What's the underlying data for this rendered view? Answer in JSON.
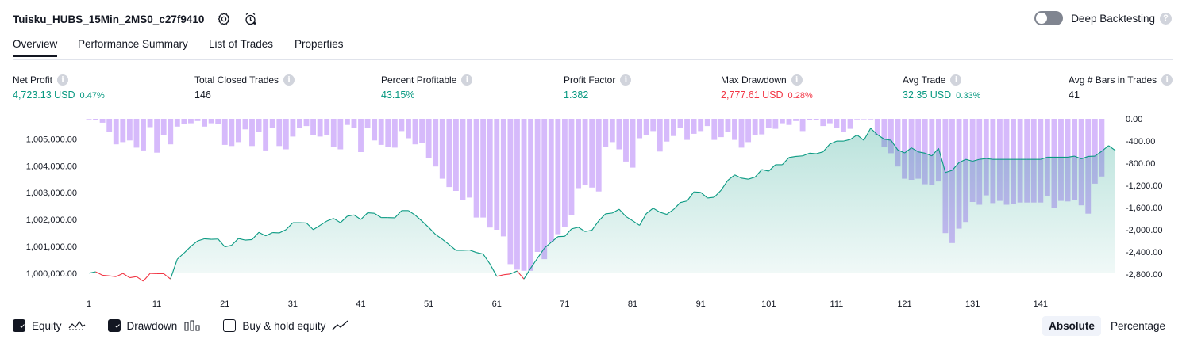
{
  "header": {
    "strategy_name": "Tuisku_HUBS_15Min_2MS0_c27f9410",
    "deep_backtesting_label": "Deep Backtesting",
    "deep_backtesting_enabled": false,
    "icons": [
      "settings-icon",
      "add-alert-icon",
      "help-icon"
    ]
  },
  "tabs": [
    {
      "label": "Overview",
      "active": true
    },
    {
      "label": "Performance Summary",
      "active": false
    },
    {
      "label": "List of Trades",
      "active": false
    },
    {
      "label": "Properties",
      "active": false
    }
  ],
  "stats": [
    {
      "label": "Net Profit",
      "value": "4,723.13 USD",
      "pct": "0.47%",
      "tone": "pos"
    },
    {
      "label": "Total Closed Trades",
      "value": "146",
      "pct": "",
      "tone": "neu"
    },
    {
      "label": "Percent Profitable",
      "value": "43.15%",
      "pct": "",
      "tone": "pos"
    },
    {
      "label": "Profit Factor",
      "value": "1.382",
      "pct": "",
      "tone": "pos"
    },
    {
      "label": "Max Drawdown",
      "value": "2,777.61 USD",
      "pct": "0.28%",
      "tone": "neg"
    },
    {
      "label": "Avg Trade",
      "value": "32.35 USD",
      "pct": "0.33%",
      "tone": "pos"
    },
    {
      "label": "Avg # Bars in Trades",
      "value": "41",
      "pct": "",
      "tone": "neu"
    }
  ],
  "legend": {
    "equity_label": "Equity",
    "drawdown_label": "Drawdown",
    "buyhold_label": "Buy & hold equity",
    "equity_checked": true,
    "drawdown_checked": true,
    "buyhold_checked": false,
    "absolute_label": "Absolute",
    "percentage_label": "Percentage",
    "mode": "absolute"
  },
  "colors": {
    "equity_up": "#089981",
    "equity_down": "#f23645",
    "drawdown_bar": "#d1b3fb",
    "positive": "#089981",
    "negative": "#f23645"
  },
  "chart_data": {
    "type": "area+bar",
    "x_ticks": [
      "1",
      "11",
      "21",
      "31",
      "41",
      "51",
      "61",
      "71",
      "81",
      "91",
      "101",
      "111",
      "121",
      "131",
      "141"
    ],
    "left_axis": {
      "ticks": [
        "1,005,000.00",
        "1,004,000.00",
        "1,003,000.00",
        "1,002,000.00",
        "1,001,000.00",
        "1,000,000.00"
      ],
      "ylim": [
        999550,
        1005750
      ],
      "baseline": 1000000
    },
    "right_axis": {
      "ticks": [
        "0.00",
        "-400.00",
        "-800.00",
        "-1,200.00",
        "-1,600.00",
        "-2,000.00",
        "-2,400.00",
        "-2,800.00"
      ],
      "ylim": [
        -3000,
        0
      ]
    },
    "series": [
      {
        "name": "Equity",
        "x_start": 1,
        "values": [
          1000000,
          1000050,
          999920,
          999900,
          999870,
          999990,
          999830,
          999870,
          999700,
          999990,
          999980,
          999980,
          999780,
          1000520,
          1000750,
          1001000,
          1001200,
          1001280,
          1001260,
          1001270,
          1000980,
          1001040,
          1001290,
          1001230,
          1001250,
          1001520,
          1001390,
          1001510,
          1001500,
          1001620,
          1001880,
          1001880,
          1001870,
          1001620,
          1001780,
          1001940,
          1002040,
          1001880,
          1002120,
          1002170,
          1002000,
          1002250,
          1002230,
          1002070,
          1002070,
          1002060,
          1002330,
          1002330,
          1002160,
          1001940,
          1001700,
          1001440,
          1001260,
          1001060,
          1000850,
          1000850,
          1000860,
          1000770,
          1000710,
          1000340,
          999880,
          999940,
          999970,
          1000080,
          999780,
          1000190,
          1000560,
          1000930,
          1001150,
          1001360,
          1001370,
          1001650,
          1001710,
          1001550,
          1001600,
          1001950,
          1002210,
          1002240,
          1002380,
          1002110,
          1001950,
          1001780,
          1002220,
          1002420,
          1002270,
          1002190,
          1002370,
          1002630,
          1002690,
          1003030,
          1003010,
          1002800,
          1002830,
          1003090,
          1003460,
          1003660,
          1003540,
          1003500,
          1003580,
          1003860,
          1003800,
          1004040,
          1004040,
          1004310,
          1004350,
          1004370,
          1004470,
          1004450,
          1004520,
          1004810,
          1004920,
          1004920,
          1004980,
          1005150,
          1004950,
          1005400,
          1005160,
          1004990,
          1004950,
          1004590,
          1004480,
          1004670,
          1004520,
          1004470,
          1004370,
          1004650,
          1003750,
          1003830,
          1004120,
          1004240,
          1004170,
          1004240,
          1004270,
          1004240,
          1004240,
          1004240,
          1004240,
          1004240,
          1004240,
          1004240,
          1004240,
          1004320,
          1004320,
          1004320,
          1004320,
          1004360,
          1004260,
          1004350,
          1004360,
          1004540,
          1004750,
          1004570
        ]
      },
      {
        "name": "Drawdown",
        "x_start": 1,
        "values": [
          -10,
          -20,
          -70,
          -240,
          -460,
          -420,
          -390,
          -520,
          -570,
          -150,
          -610,
          -300,
          -460,
          -140,
          -100,
          -80,
          -40,
          -140,
          -80,
          -100,
          -470,
          -490,
          -420,
          -190,
          -490,
          -230,
          -570,
          -170,
          -490,
          -550,
          -320,
          -160,
          -130,
          -300,
          -320,
          -300,
          -500,
          -550,
          -110,
          -170,
          -600,
          -160,
          -390,
          -470,
          -500,
          -520,
          -220,
          -350,
          -460,
          -440,
          -700,
          -860,
          -1080,
          -1230,
          -1300,
          -1460,
          -1420,
          -1780,
          -1780,
          -1960,
          -2000,
          -2120,
          -2620,
          -2720,
          -2740,
          -2740,
          -2400,
          -2530,
          -2220,
          -2080,
          -1950,
          -1740,
          -1250,
          -1200,
          -1240,
          -1310,
          -500,
          -420,
          -550,
          -770,
          -880,
          -350,
          -290,
          -220,
          -590,
          -410,
          -310,
          -170,
          -380,
          -270,
          -220,
          -130,
          -380,
          -330,
          -240,
          -380,
          -520,
          -420,
          -300,
          -280,
          -160,
          -180,
          -80,
          -110,
          -40,
          -220,
          -20,
          -20,
          -130,
          -80,
          -160,
          -230,
          -180,
          -10,
          0,
          -10,
          -290,
          -500,
          -620,
          -860,
          -1080,
          -1100,
          -1080,
          -1180,
          -1200,
          -1130,
          -2060,
          -2240,
          -1980,
          -1860,
          -1500,
          -1550,
          -1380,
          -1520,
          -1480,
          -1550,
          -1540,
          -1510,
          -1510,
          -1510,
          -1510,
          -1390,
          -1600,
          -1480,
          -1490,
          -1460,
          -1560,
          -1710,
          -1170,
          -1040
        ]
      }
    ]
  }
}
